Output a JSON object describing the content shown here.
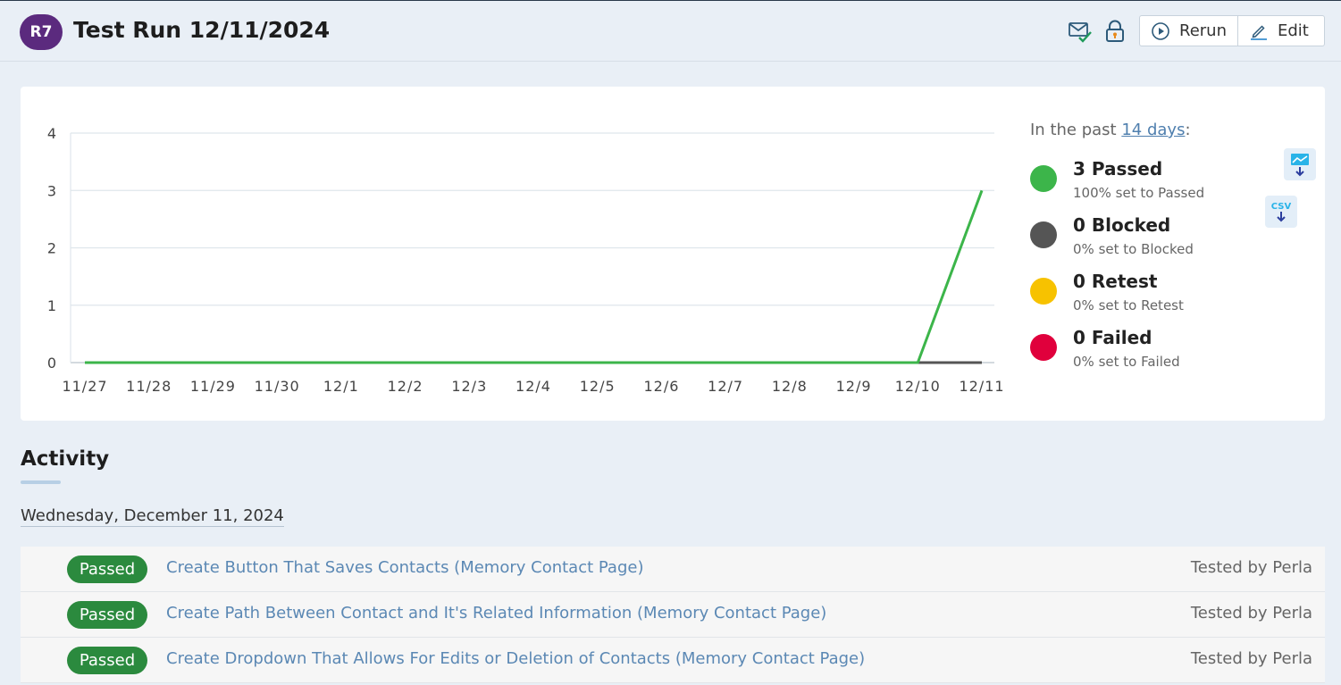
{
  "header": {
    "badge": "R7",
    "title": "Test Run 12/11/2024",
    "rerun_label": "Rerun",
    "edit_label": "Edit",
    "icons": [
      "email-check-icon",
      "lock-icon",
      "play-circle-icon",
      "pencil-icon"
    ]
  },
  "legend": {
    "heading_prefix": "In the past ",
    "heading_link": "14 days",
    "heading_suffix": ":",
    "items": [
      {
        "count_label": "3 Passed",
        "sub_label": "100% set to Passed",
        "color": "#3cb54a"
      },
      {
        "count_label": "0 Blocked",
        "sub_label": "0% set to Blocked",
        "color": "#555555"
      },
      {
        "count_label": "0 Retest",
        "sub_label": "0% set to Retest",
        "color": "#f7c200"
      },
      {
        "count_label": "0 Failed",
        "sub_label": "0% set to Failed",
        "color": "#e0003c"
      }
    ],
    "export_image_icon": "chart-download-icon",
    "export_csv_label": "CSV"
  },
  "chart_data": {
    "type": "line",
    "title": "",
    "xlabel": "",
    "ylabel": "",
    "categories": [
      "11/27",
      "11/28",
      "11/29",
      "11/30",
      "12/1",
      "12/2",
      "12/3",
      "12/4",
      "12/5",
      "12/6",
      "12/7",
      "12/8",
      "12/9",
      "12/10",
      "12/11"
    ],
    "ylim": [
      0,
      4
    ],
    "yticks": [
      0,
      1,
      2,
      3,
      4
    ],
    "grid": true,
    "series": [
      {
        "color": "#555555",
        "values": [
          0,
          0,
          0,
          0,
          0,
          0,
          0,
          0,
          0,
          0,
          0,
          0,
          0,
          0,
          0
        ]
      },
      {
        "color": "#3cb54a",
        "values": [
          0,
          0,
          0,
          0,
          0,
          0,
          0,
          0,
          0,
          0,
          0,
          0,
          0,
          0,
          3
        ]
      }
    ]
  },
  "activity": {
    "title": "Activity",
    "date": "Wednesday, December 11, 2024",
    "rows": [
      {
        "status": "Passed",
        "test": "Create Button That Saves Contacts (Memory Contact Page)",
        "tester": "Tested by Perla"
      },
      {
        "status": "Passed",
        "test": "Create Path Between Contact and It's Related Information (Memory Contact Page)",
        "tester": "Tested by Perla"
      },
      {
        "status": "Passed",
        "test": "Create Dropdown That Allows For Edits or Deletion of Contacts (Memory Contact Page)",
        "tester": "Tested by Perla"
      }
    ]
  }
}
